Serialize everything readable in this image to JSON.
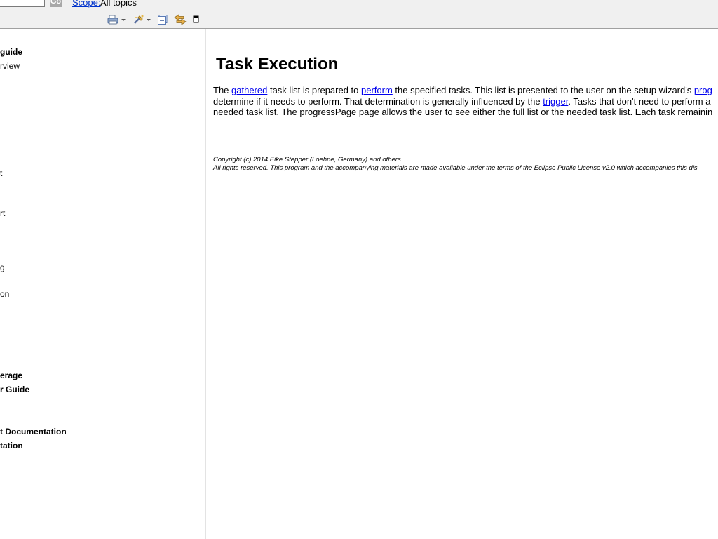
{
  "search": {
    "value": "",
    "go_label": "Go",
    "scope_label": "Scope:",
    "scope_value": "All topics"
  },
  "toolbar": {
    "icons": [
      "print-icon",
      "highlight-search-icon",
      "collapse-all-icon",
      "link-with-contents-icon",
      "maximize-icon"
    ]
  },
  "toc": {
    "items": [
      {
        "label": "guide",
        "bold": true
      },
      {
        "label": "rview",
        "bold": false
      },
      {
        "label": "t",
        "bold": false
      },
      {
        "label": "rt",
        "bold": false
      },
      {
        "label": "g",
        "bold": false
      },
      {
        "label": "on",
        "bold": false
      },
      {
        "label": "erage",
        "bold": true
      },
      {
        "label": "r Guide",
        "bold": true
      },
      {
        "label": "t Documentation",
        "bold": true
      },
      {
        "label": "tation",
        "bold": true
      }
    ]
  },
  "content": {
    "title": "Task Execution",
    "para": {
      "l1_a": "The ",
      "l1_link1": "gathered",
      "l1_b": " task list is prepared to ",
      "l1_link2": "perform",
      "l1_c": " the specified tasks. This list is presented to the user on the setup wizard's ",
      "l1_link3": "prog",
      "l2_a": "determine if it needs to perform. That determination is generally influenced by the ",
      "l2_link": "trigger",
      "l2_b": ". Tasks that don't need to perform a",
      "l3": "needed task list. The progressPage page allows the user to see either the full list or the needed task list. Each task remainin"
    },
    "copyright_line1": "Copyright (c) 2014 Eike Stepper (Loehne, Germany) and others.",
    "copyright_line2": "All rights reserved. This program and the accompanying materials are made available under the terms of the Eclipse Public License v2.0 which accompanies this dis"
  },
  "colors": {
    "link": "#0000ee",
    "chrome_bg": "#f0f0f0",
    "go_button_bg": "#a8a8a8"
  }
}
